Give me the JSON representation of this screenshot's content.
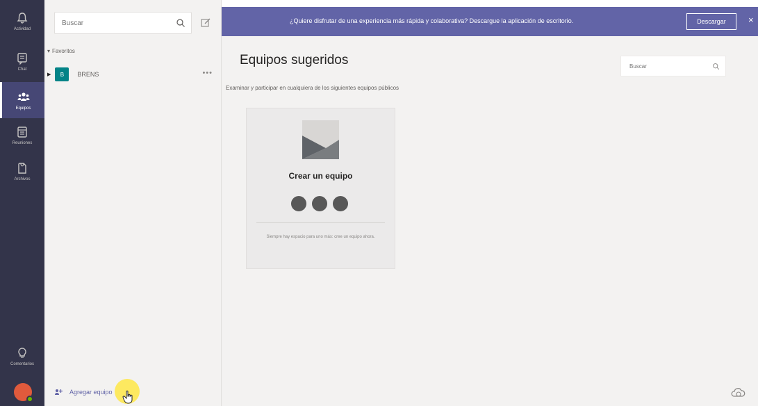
{
  "rail": {
    "items": [
      {
        "label": "Actividad",
        "icon": "bell-icon"
      },
      {
        "label": "Chat",
        "icon": "chat-icon"
      },
      {
        "label": "Equipos",
        "icon": "teams-icon",
        "active": true
      },
      {
        "label": "Reuniones",
        "icon": "calendar-icon"
      },
      {
        "label": "Archivos",
        "icon": "file-icon"
      }
    ],
    "feedback": {
      "label": "Comentarios",
      "icon": "lightbulb-icon"
    }
  },
  "sidebar": {
    "search_placeholder": "Buscar",
    "favorites_label": "Favoritos",
    "team": {
      "initial": "B",
      "name": "BRENS",
      "more": "•••"
    },
    "join_label": "Agregar equipo"
  },
  "banner": {
    "message": "¿Quiere disfrutar de una experiencia más rápida y colaborativa? Descargue la aplicación de escritorio.",
    "button": "Descargar",
    "close": "×"
  },
  "main": {
    "title": "Equipos sugeridos",
    "subtitle": "Examinar y participar en cualquiera de los siguientes equipos públicos",
    "search_placeholder": "Buscar",
    "card": {
      "title": "Crear un equipo",
      "description": "Siempre hay espacio para uno más: cree un equipo ahora."
    }
  },
  "colors": {
    "rail": "#33344a",
    "accent": "#6264a7",
    "team_tile": "#038387"
  }
}
